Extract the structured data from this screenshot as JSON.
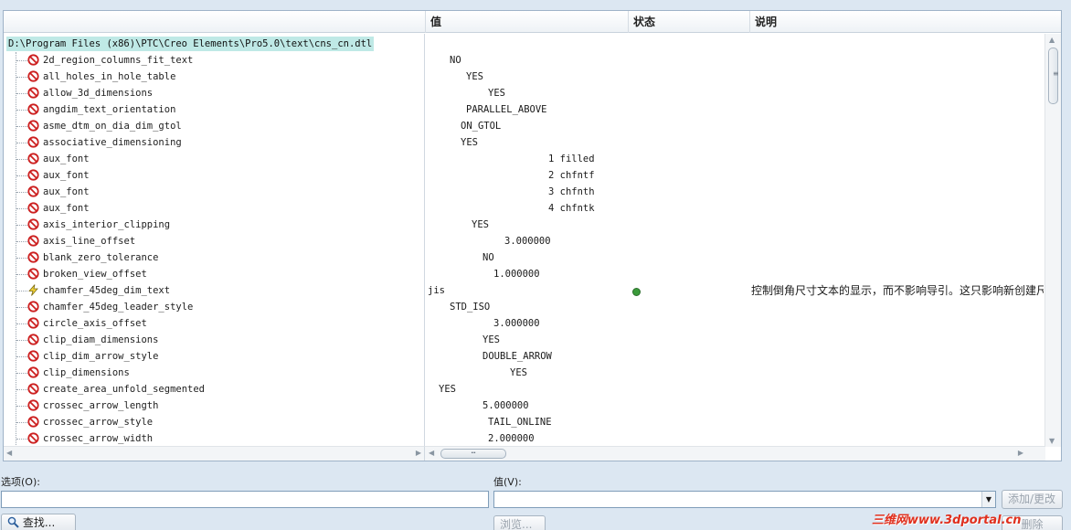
{
  "columns": {
    "value": "值",
    "status": "状态",
    "description": "说明"
  },
  "tree": {
    "root_path": "D:\\Program Files (x86)\\PTC\\Creo Elements\\Pro5.0\\text\\cns_cn.dtl"
  },
  "options": [
    {
      "name": "2d_region_columns_fit_text",
      "value": "NO",
      "icon": "ban-icon"
    },
    {
      "name": "all_holes_in_hole_table",
      "value": "YES",
      "icon": "ban-icon"
    },
    {
      "name": "allow_3d_dimensions",
      "value": "YES",
      "icon": "ban-icon"
    },
    {
      "name": "angdim_text_orientation",
      "value": "PARALLEL_ABOVE",
      "icon": "ban-icon"
    },
    {
      "name": "asme_dtm_on_dia_dim_gtol",
      "value": "ON_GTOL",
      "icon": "ban-icon"
    },
    {
      "name": "associative_dimensioning",
      "value": "YES",
      "icon": "ban-icon"
    },
    {
      "name": "aux_font",
      "value": "1 filled",
      "icon": "ban-icon"
    },
    {
      "name": "aux_font",
      "value": "2 chfntf",
      "icon": "ban-icon"
    },
    {
      "name": "aux_font",
      "value": "3 chfnth",
      "icon": "ban-icon"
    },
    {
      "name": "aux_font",
      "value": "4 chfntk",
      "icon": "ban-icon"
    },
    {
      "name": "axis_interior_clipping",
      "value": "YES",
      "icon": "ban-icon"
    },
    {
      "name": "axis_line_offset",
      "value": "3.000000",
      "icon": "ban-icon"
    },
    {
      "name": "blank_zero_tolerance",
      "value": "NO",
      "icon": "ban-icon"
    },
    {
      "name": "broken_view_offset",
      "value": "1.000000",
      "icon": "ban-icon"
    },
    {
      "name": "chamfer_45deg_dim_text",
      "value": "jis",
      "icon": "lightning-icon",
      "status": "active",
      "description": "控制倒角尺寸文本的显示，而不影响导引。这只影响新创建尺"
    },
    {
      "name": "chamfer_45deg_leader_style",
      "value": "STD_ISO",
      "icon": "ban-icon"
    },
    {
      "name": "circle_axis_offset",
      "value": "3.000000",
      "icon": "ban-icon"
    },
    {
      "name": "clip_diam_dimensions",
      "value": "YES",
      "icon": "ban-icon"
    },
    {
      "name": "clip_dim_arrow_style",
      "value": "DOUBLE_ARROW",
      "icon": "ban-icon"
    },
    {
      "name": "clip_dimensions",
      "value": "YES",
      "icon": "ban-icon"
    },
    {
      "name": "create_area_unfold_segmented",
      "value": "YES",
      "icon": "ban-icon"
    },
    {
      "name": "crossec_arrow_length",
      "value": "5.000000",
      "icon": "ban-icon"
    },
    {
      "name": "crossec_arrow_style",
      "value": "TAIL_ONLINE",
      "icon": "ban-icon"
    },
    {
      "name": "crossec_arrow_width",
      "value": "2.000000",
      "icon": "ban-icon"
    }
  ],
  "form": {
    "option_label": "选项(O):",
    "option_value": "",
    "value_label": "值(V):",
    "value_value": "",
    "add_change_label": "添加/更改",
    "find_label": "查找...",
    "browse_label": "浏览...",
    "delete_label": "删除"
  },
  "watermark": "三维网www.3dportal.cn",
  "colors": {
    "selected_bg": "#bfe9e6",
    "ban_red": "#cc1f1f",
    "status_green": "#3a9a3a"
  }
}
